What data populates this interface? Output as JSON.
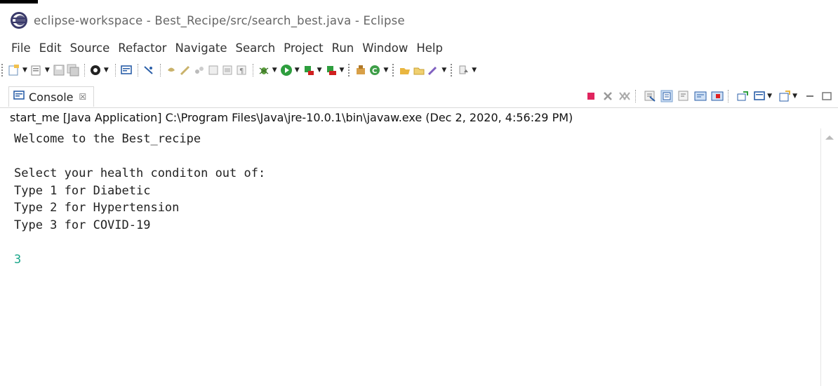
{
  "window": {
    "title": "eclipse-workspace - Best_Recipe/src/search_best.java - Eclipse"
  },
  "menu": [
    "File",
    "Edit",
    "Source",
    "Refactor",
    "Navigate",
    "Search",
    "Project",
    "Run",
    "Window",
    "Help"
  ],
  "console_view": {
    "tab_label": "Console",
    "close_glyph": "☒",
    "launch_info": "start_me [Java Application] C:\\Program Files\\Java\\jre-10.0.1\\bin\\javaw.exe (Dec 2, 2020, 4:56:29 PM)",
    "lines": [
      "Welcome to the Best_recipe",
      "",
      "Select your health conditon out of:",
      "Type 1 for Diabetic",
      "Type 2 for Hypertension",
      "Type 3 for COVID-19",
      ""
    ],
    "user_input": "3"
  },
  "colors": {
    "input_text": "#1aa68a",
    "terminate": "#e0245e"
  },
  "icons": [
    "new-file-icon",
    "save-icon",
    "debug-icon",
    "run-icon",
    "console-icon",
    "terminate-icon",
    "remove-launch-icon",
    "scroll-lock-icon",
    "pin-icon",
    "minimize-icon",
    "maximize-icon"
  ]
}
